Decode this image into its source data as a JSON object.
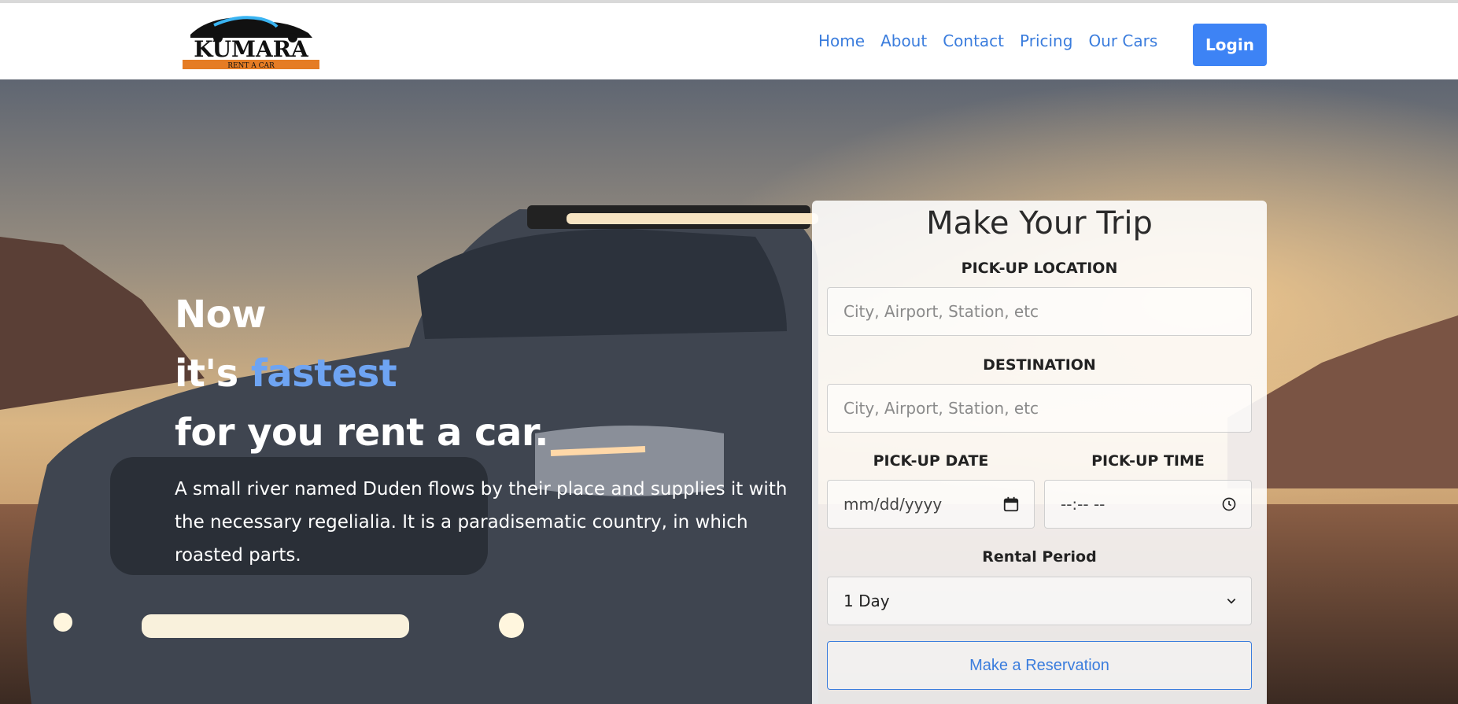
{
  "brand": {
    "logo_text": "KUMARA",
    "logo_subtext": "RENT A CAR"
  },
  "nav": {
    "items": [
      {
        "label": "Home"
      },
      {
        "label": "About"
      },
      {
        "label": "Contact"
      },
      {
        "label": "Pricing"
      },
      {
        "label": "Our Cars"
      }
    ],
    "login_label": "Login"
  },
  "hero": {
    "line1": "Now",
    "line2_prefix": "it's ",
    "line2_accent": "fastest",
    "line3": "for you rent a car.",
    "paragraph": "A small river named Duden flows by their place and supplies it with the necessary regelialia. It is a paradisematic country, in which roasted parts."
  },
  "form": {
    "title": "Make Your Trip",
    "pickup_location_label": "PICK-UP LOCATION",
    "pickup_location_placeholder": "City, Airport, Station, etc",
    "destination_label": "DESTINATION",
    "destination_placeholder": "City, Airport, Station, etc",
    "pickup_date_label": "PICK-UP DATE",
    "pickup_date_value": "mm/dd/yyyy",
    "pickup_time_label": "PICK-UP TIME",
    "pickup_time_value": "--:-- --",
    "rental_period_label": "Rental Period",
    "rental_period_selected": "1 Day",
    "submit_label": "Make a Reservation"
  },
  "colors": {
    "accent": "#3d83f5",
    "link": "#3b7ddd",
    "headline_accent": "#6ea4f3",
    "logo_orange": "#e57c24"
  },
  "icons": [
    "calendar-icon",
    "clock-icon",
    "chevron-down-icon"
  ]
}
